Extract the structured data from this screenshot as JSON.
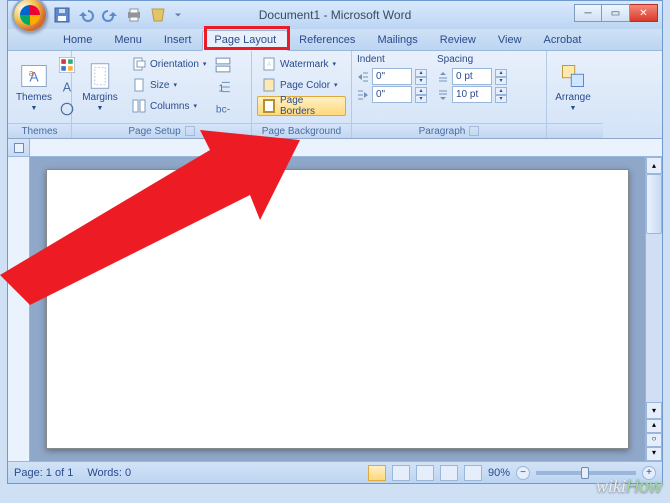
{
  "title": "Document1 - Microsoft Word",
  "tabs": [
    "Home",
    "Menu",
    "Insert",
    "Page Layout",
    "References",
    "Mailings",
    "Review",
    "View",
    "Acrobat"
  ],
  "active_tab": 3,
  "ribbon": {
    "themes": {
      "label": "Themes",
      "btn": "Themes"
    },
    "page_setup": {
      "label": "Page Setup",
      "margins": "Margins",
      "orientation": "Orientation",
      "size": "Size",
      "columns": "Columns"
    },
    "page_background": {
      "label": "Page Background",
      "watermark": "Watermark",
      "page_color": "Page Color",
      "page_borders": "Page Borders"
    },
    "paragraph": {
      "label": "Paragraph",
      "indent_label": "Indent",
      "spacing_label": "Spacing",
      "indent_left": "0\"",
      "indent_right": "0\"",
      "spacing_before": "0 pt",
      "spacing_after": "10 pt"
    },
    "arrange": {
      "label": "Arrange",
      "btn": "Arrange"
    }
  },
  "status": {
    "page": "Page: 1 of 1",
    "words": "Words: 0",
    "zoom": "90%"
  },
  "watermark": "wikiHow"
}
